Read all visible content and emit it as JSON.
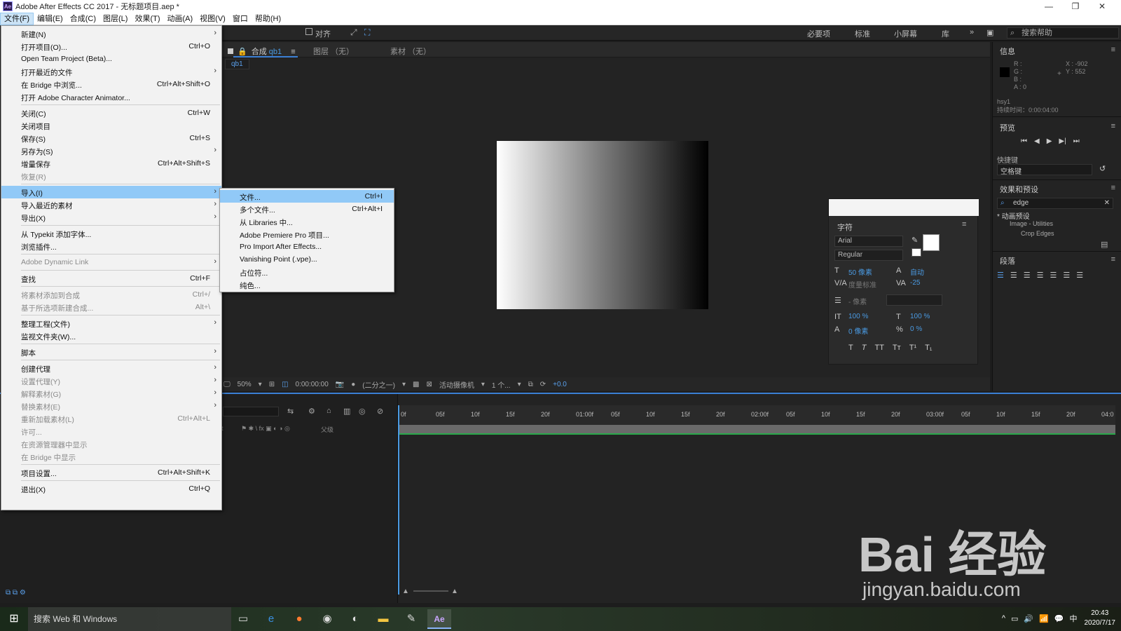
{
  "window": {
    "title": "Adobe After Effects CC 2017 - 无标题项目.aep *",
    "app_icon": "Ae",
    "controls": [
      "—",
      "❐",
      "✕"
    ]
  },
  "menubar": [
    "文件(F)",
    "编辑(E)",
    "合成(C)",
    "图层(L)",
    "效果(T)",
    "动画(A)",
    "视图(V)",
    "窗口",
    "帮助(H)"
  ],
  "toolbar": {
    "snap_label": "对齐",
    "workspaces": [
      "必要项",
      "标准",
      "小屏幕",
      "库"
    ],
    "search_placeholder": "搜索帮助"
  },
  "file_menu": [
    {
      "label": "新建(N)",
      "shortcut": "",
      "arrow": true,
      "disabled": false
    },
    {
      "label": "打开项目(O)...",
      "shortcut": "Ctrl+O",
      "arrow": false,
      "disabled": false
    },
    {
      "label": "Open Team Project (Beta)...",
      "shortcut": "",
      "arrow": false,
      "disabled": false
    },
    {
      "label": "打开最近的文件",
      "shortcut": "",
      "arrow": true,
      "disabled": false
    },
    {
      "label": "在 Bridge 中浏览...",
      "shortcut": "Ctrl+Alt+Shift+O",
      "arrow": false,
      "disabled": false
    },
    {
      "label": "打开 Adobe Character Animator...",
      "shortcut": "",
      "arrow": false,
      "disabled": false
    },
    {
      "separator": true
    },
    {
      "label": "关闭(C)",
      "shortcut": "Ctrl+W",
      "arrow": false,
      "disabled": false
    },
    {
      "label": "关闭项目",
      "shortcut": "",
      "arrow": false,
      "disabled": false
    },
    {
      "label": "保存(S)",
      "shortcut": "Ctrl+S",
      "arrow": false,
      "disabled": false
    },
    {
      "label": "另存为(S)",
      "shortcut": "",
      "arrow": true,
      "disabled": false
    },
    {
      "label": "增量保存",
      "shortcut": "Ctrl+Alt+Shift+S",
      "arrow": false,
      "disabled": false
    },
    {
      "label": "恢复(R)",
      "shortcut": "",
      "arrow": false,
      "disabled": true
    },
    {
      "separator": true
    },
    {
      "label": "导入(I)",
      "shortcut": "",
      "arrow": true,
      "disabled": false,
      "highlighted": true
    },
    {
      "label": "导入最近的素材",
      "shortcut": "",
      "arrow": true,
      "disabled": false
    },
    {
      "label": "导出(X)",
      "shortcut": "",
      "arrow": true,
      "disabled": false
    },
    {
      "separator": true
    },
    {
      "label": "从 Typekit 添加字体...",
      "shortcut": "",
      "arrow": false,
      "disabled": false
    },
    {
      "label": "浏览插件...",
      "shortcut": "",
      "arrow": false,
      "disabled": false
    },
    {
      "separator": true
    },
    {
      "label": "Adobe Dynamic Link",
      "shortcut": "",
      "arrow": true,
      "disabled": true
    },
    {
      "separator": true
    },
    {
      "label": "查找",
      "shortcut": "Ctrl+F",
      "arrow": false,
      "disabled": false
    },
    {
      "separator": true
    },
    {
      "label": "将素材添加到合成",
      "shortcut": "Ctrl+/",
      "arrow": false,
      "disabled": true
    },
    {
      "label": "基于所选项新建合成...",
      "shortcut": "Alt+\\",
      "arrow": false,
      "disabled": true
    },
    {
      "separator": true
    },
    {
      "label": "整理工程(文件)",
      "shortcut": "",
      "arrow": true,
      "disabled": false
    },
    {
      "label": "监视文件夹(W)...",
      "shortcut": "",
      "arrow": false,
      "disabled": false
    },
    {
      "separator": true
    },
    {
      "label": "脚本",
      "shortcut": "",
      "arrow": true,
      "disabled": false
    },
    {
      "separator": true
    },
    {
      "label": "创建代理",
      "shortcut": "",
      "arrow": true,
      "disabled": false
    },
    {
      "label": "设置代理(Y)",
      "shortcut": "",
      "arrow": true,
      "disabled": true
    },
    {
      "label": "解释素材(G)",
      "shortcut": "",
      "arrow": true,
      "disabled": true
    },
    {
      "label": "替换素材(E)",
      "shortcut": "",
      "arrow": true,
      "disabled": true
    },
    {
      "label": "重新加载素材(L)",
      "shortcut": "Ctrl+Alt+L",
      "arrow": false,
      "disabled": true
    },
    {
      "label": "许可...",
      "shortcut": "",
      "arrow": false,
      "disabled": true
    },
    {
      "label": "在资源管理器中显示",
      "shortcut": "",
      "arrow": false,
      "disabled": true
    },
    {
      "label": "在 Bridge 中显示",
      "shortcut": "",
      "arrow": false,
      "disabled": true
    },
    {
      "separator": true
    },
    {
      "label": "项目设置...",
      "shortcut": "Ctrl+Alt+Shift+K",
      "arrow": false,
      "disabled": false
    },
    {
      "separator": true
    },
    {
      "label": "退出(X)",
      "shortcut": "Ctrl+Q",
      "arrow": false,
      "disabled": false
    }
  ],
  "import_submenu": [
    {
      "label": "文件...",
      "shortcut": "Ctrl+I",
      "highlighted": true
    },
    {
      "label": "多个文件...",
      "shortcut": "Ctrl+Alt+I"
    },
    {
      "label": "从 Libraries 中...",
      "shortcut": ""
    },
    {
      "label": "Adobe Premiere Pro 项目...",
      "shortcut": ""
    },
    {
      "label": "Pro Import After Effects...",
      "shortcut": ""
    },
    {
      "label": "Vanishing Point (.vpe)...",
      "shortcut": ""
    },
    {
      "label": "占位符...",
      "shortcut": ""
    },
    {
      "label": "纯色...",
      "shortcut": ""
    }
  ],
  "comp_panel": {
    "tab_comp_prefix": "合成",
    "tab_comp_name": "qb1",
    "tab_layer": "图层 （无）",
    "tab_footage": "素材 （无）",
    "sub_tab": "qb1",
    "gradient_colors": [
      "#ffffff",
      "#000000"
    ],
    "viewer": {
      "zoom": "50%",
      "timecode": "0:00:00:00",
      "resolution": "(二分之一)",
      "camera": "活动摄像机",
      "views": "1 个...",
      "exposure": "+0.0"
    }
  },
  "character_panel": {
    "title": "字符",
    "font": "Arial",
    "style": "Regular",
    "font_size": "50 像素",
    "leading": "自动",
    "kerning": "度量标准",
    "tracking": "-25",
    "stroke_width": "- 像素",
    "vert_scale": "100 %",
    "horiz_scale": "100 %",
    "baseline_shift": "0 像素",
    "tsume": "0 %",
    "format_buttons": [
      "T",
      "T",
      "TT",
      "Tт",
      "T¹",
      "T₁"
    ]
  },
  "info_panel": {
    "title": "信息",
    "r": "R :",
    "g": "G :",
    "b": "B :",
    "a": "A : 0",
    "x": "X : -902",
    "y": "Y : 552",
    "item_name": "hsy1",
    "duration": "持续时间：0:00:04:00"
  },
  "preview_panel": {
    "title": "预览",
    "shortcut_label": "快捷键",
    "shortcut_value": "空格键"
  },
  "effects_panel": {
    "title": "效果和预设",
    "search_value": "edge",
    "tree": [
      "* 动画预设",
      "Image - Utilities",
      "Crop Edges"
    ]
  },
  "paragraph_panel": {
    "title": "段落"
  },
  "timeline": {
    "ruler_ticks": [
      "0f",
      "05f",
      "10f",
      "15f",
      "20f",
      "01:00f",
      "05f",
      "10f",
      "15f",
      "20f",
      "02:00f",
      "05f",
      "10f",
      "15f",
      "20f",
      "03:00f",
      "05f",
      "10f",
      "15f",
      "20f",
      "04:0"
    ],
    "parent_label": "父级",
    "source_label": "t"
  },
  "taskbar": {
    "search_placeholder": "搜索 Web 和 Windows",
    "time": "20:43",
    "date": "2020/7/17",
    "ime": "中"
  },
  "watermark": {
    "brand": "Bai 经验",
    "url": "jingyan.baidu.com"
  }
}
